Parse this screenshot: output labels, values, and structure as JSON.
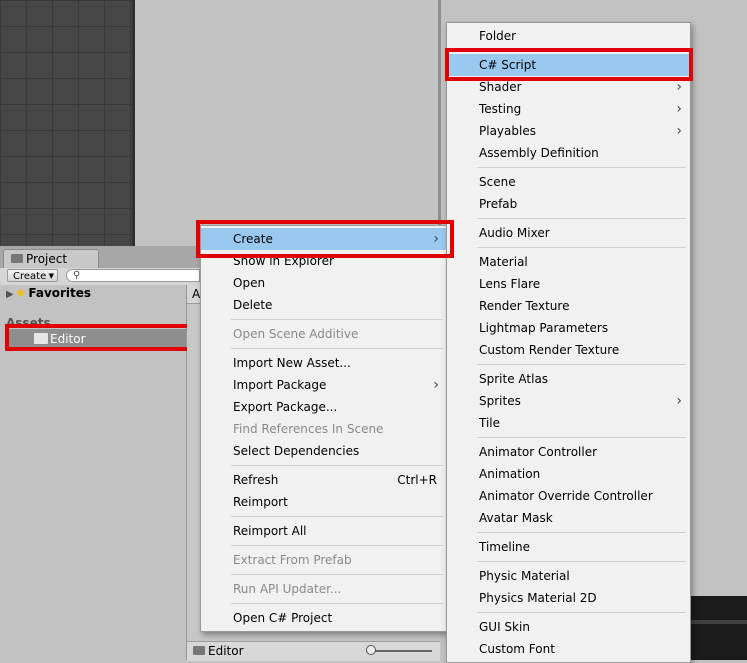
{
  "project_window": {
    "tab_label": "Project",
    "create_dropdown": "Create",
    "favorites_label": "Favorites",
    "assets_label": "Assets",
    "editor_folder": "Editor",
    "right_pane_crumb": "A",
    "bottom_path": "Editor"
  },
  "context_menu": [
    {
      "label": "Create",
      "submenu": true,
      "selected": true
    },
    {
      "label": "Show in Explorer"
    },
    {
      "label": "Open"
    },
    {
      "label": "Delete"
    },
    {
      "separator": true
    },
    {
      "label": "Open Scene Additive",
      "disabled": true
    },
    {
      "separator": true
    },
    {
      "label": "Import New Asset..."
    },
    {
      "label": "Import Package",
      "submenu": true
    },
    {
      "label": "Export Package..."
    },
    {
      "label": "Find References In Scene",
      "disabled": true
    },
    {
      "label": "Select Dependencies"
    },
    {
      "separator": true
    },
    {
      "label": "Refresh",
      "shortcut": "Ctrl+R"
    },
    {
      "label": "Reimport"
    },
    {
      "separator": true
    },
    {
      "label": "Reimport All"
    },
    {
      "separator": true
    },
    {
      "label": "Extract From Prefab",
      "disabled": true
    },
    {
      "separator": true
    },
    {
      "label": "Run API Updater...",
      "disabled": true
    },
    {
      "separator": true
    },
    {
      "label": "Open C# Project"
    }
  ],
  "create_submenu": [
    {
      "label": "Folder"
    },
    {
      "separator": true
    },
    {
      "label": "C# Script",
      "selected": true
    },
    {
      "label": "Shader",
      "submenu": true
    },
    {
      "label": "Testing",
      "submenu": true
    },
    {
      "label": "Playables",
      "submenu": true
    },
    {
      "label": "Assembly Definition"
    },
    {
      "separator": true
    },
    {
      "label": "Scene"
    },
    {
      "label": "Prefab"
    },
    {
      "separator": true
    },
    {
      "label": "Audio Mixer"
    },
    {
      "separator": true
    },
    {
      "label": "Material"
    },
    {
      "label": "Lens Flare"
    },
    {
      "label": "Render Texture"
    },
    {
      "label": "Lightmap Parameters"
    },
    {
      "label": "Custom Render Texture"
    },
    {
      "separator": true
    },
    {
      "label": "Sprite Atlas"
    },
    {
      "label": "Sprites",
      "submenu": true
    },
    {
      "label": "Tile"
    },
    {
      "separator": true
    },
    {
      "label": "Animator Controller"
    },
    {
      "label": "Animation"
    },
    {
      "label": "Animator Override Controller"
    },
    {
      "label": "Avatar Mask"
    },
    {
      "separator": true
    },
    {
      "label": "Timeline"
    },
    {
      "separator": true
    },
    {
      "label": "Physic Material"
    },
    {
      "label": "Physics Material 2D"
    },
    {
      "separator": true
    },
    {
      "label": "GUI Skin"
    },
    {
      "label": "Custom Font"
    }
  ],
  "icons": {
    "submenu_arrow": "chevron-right-icon",
    "favorites": "star-icon",
    "folder": "folder-icon",
    "search": "search-icon"
  },
  "colors": {
    "highlight_box": "#e00000",
    "menu_selection": "#99c9ef",
    "menu_background": "#f1f1f1"
  }
}
